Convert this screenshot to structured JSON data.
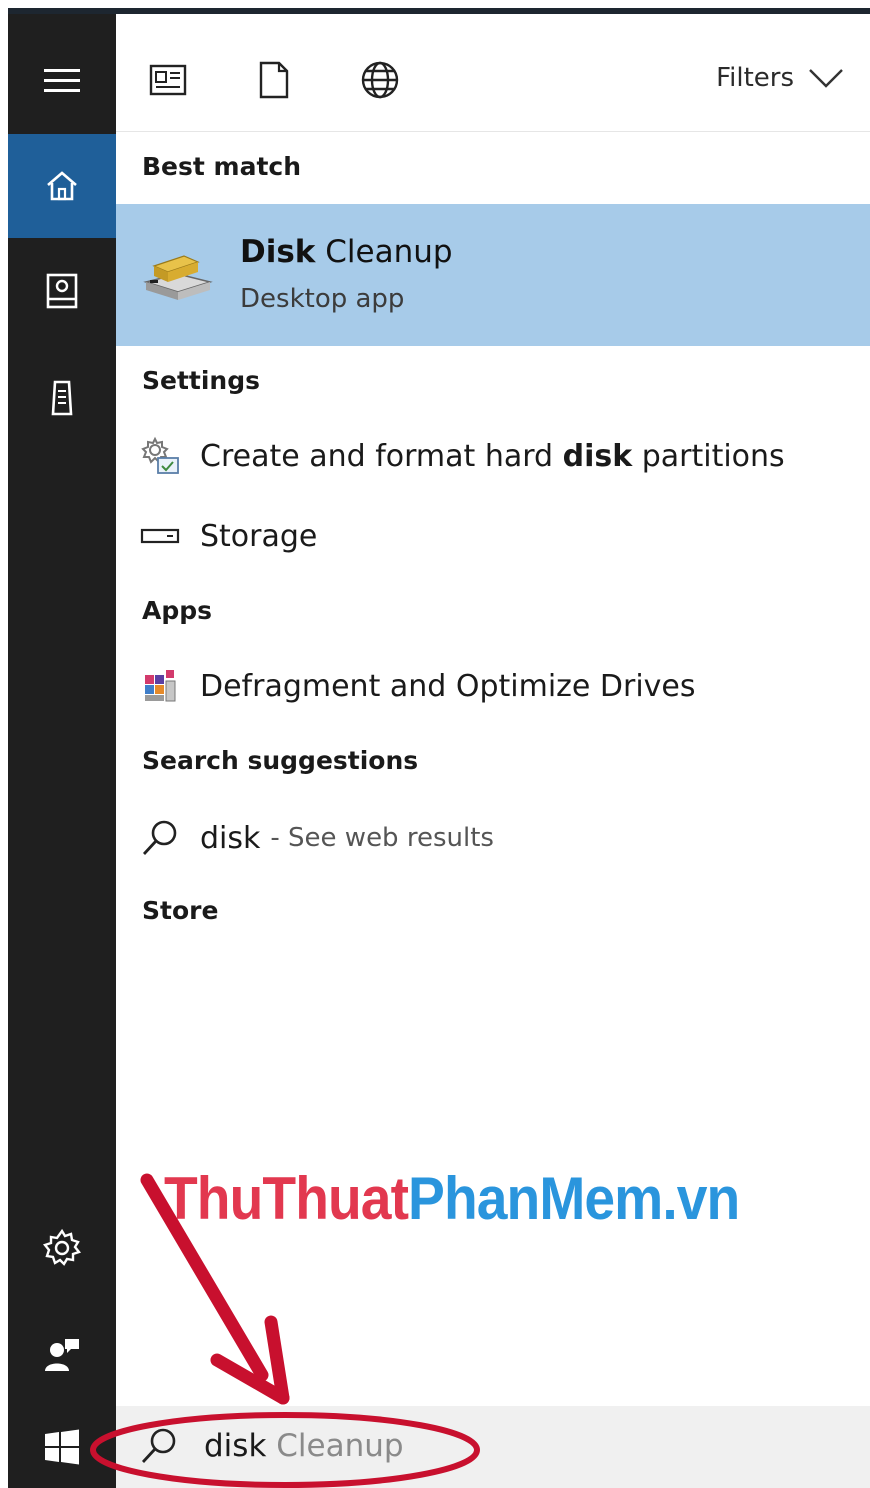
{
  "toolbar": {
    "filters_label": "Filters",
    "icons": [
      "news-icon",
      "document-icon",
      "web-globe-icon"
    ]
  },
  "sections": {
    "best_match": "Best match",
    "settings": "Settings",
    "apps": "Apps",
    "search_suggestions": "Search suggestions",
    "store": "Store"
  },
  "best_match": {
    "title_bold": "Disk",
    "title_rest": " Cleanup",
    "subtitle": "Desktop app"
  },
  "settings_items": [
    {
      "pre": "Create and format hard ",
      "bold": "disk",
      "post": " partitions"
    },
    {
      "label": "Storage"
    }
  ],
  "apps_items": [
    {
      "label": "Defragment and Optimize Drives"
    }
  ],
  "suggestions": [
    {
      "term": "disk",
      "hint": "- See web results"
    }
  ],
  "watermark": {
    "part_a": "ThuThuat",
    "part_b": "PhanMem.vn"
  },
  "search": {
    "typed": "disk",
    "suggested": " Cleanup"
  },
  "colors": {
    "sidebar": "#1f1f1f",
    "sidebar_active": "#1f5f99",
    "best_match_bg": "#a7cbe9",
    "annotation_red": "#c8102e",
    "watermark_red": "#e2384f",
    "watermark_blue": "#2a95dd"
  }
}
